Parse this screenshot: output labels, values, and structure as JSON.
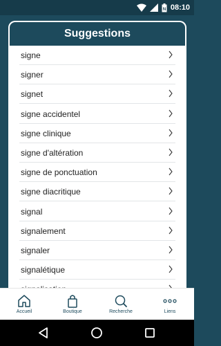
{
  "status_bar": {
    "time": "08:10",
    "icons": [
      "wifi-icon",
      "signal-icon",
      "battery-icon"
    ]
  },
  "header": {
    "title": "Suggestions"
  },
  "suggestions": [
    "signe",
    "signer",
    "signet",
    "signe accidentel",
    "signe clinique",
    "signe d'altération",
    "signe de ponctuation",
    "signe diacritique",
    "signal",
    "signalement",
    "signaler",
    "signalétique",
    "signalisation"
  ],
  "bottom_nav": [
    {
      "label": "Accueil",
      "icon": "home-icon"
    },
    {
      "label": "Boutique",
      "icon": "shopping-bag-icon"
    },
    {
      "label": "Recherche",
      "icon": "search-icon"
    },
    {
      "label": "Liens",
      "icon": "more-icon"
    }
  ],
  "system_nav": [
    "back-icon",
    "home-circle-icon",
    "recents-icon"
  ],
  "colors": {
    "primary": "#1d4a5c",
    "status_bar": "#163b4a",
    "surface": "#ffffff",
    "text": "#222222"
  }
}
